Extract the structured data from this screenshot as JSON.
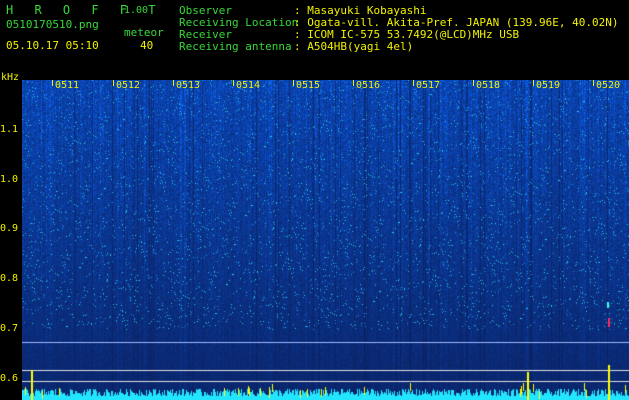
{
  "app": {
    "title": "H R O F F T",
    "version": "1.00"
  },
  "file": {
    "name": "0510170510.png",
    "datetime": "05.10.17 05:10"
  },
  "meteor": {
    "label": "meteor",
    "count": "40"
  },
  "info": [
    {
      "key": "Observer",
      "value": ": Masayuki Kobayashi"
    },
    {
      "key": "Receiving Location",
      "value": ": Ogata-vill. Akita-Pref. JAPAN (139.96E, 40.02N)"
    },
    {
      "key": "Receiver",
      "value": ": ICOM IC-575 53.7492(@LCD)MHz USB"
    },
    {
      "key": "Receiving antenna",
      "value": ": A504HB(yagi 4el)"
    }
  ],
  "yaxis": {
    "unit": "kHz",
    "ticks": [
      "1.1",
      "1.0",
      "0.9",
      "0.8",
      "0.7",
      "0.6"
    ]
  },
  "xaxis": {
    "ticks": [
      "0511",
      "0512",
      "0513",
      "0514",
      "0515",
      "0516",
      "0517",
      "0518",
      "0519",
      "0520"
    ]
  },
  "colors": {
    "text_green": "#37d937",
    "text_yellow": "#f2f200",
    "background": "#000000",
    "noise_base": "#1840c8",
    "cyan": "#22e6ff"
  }
}
